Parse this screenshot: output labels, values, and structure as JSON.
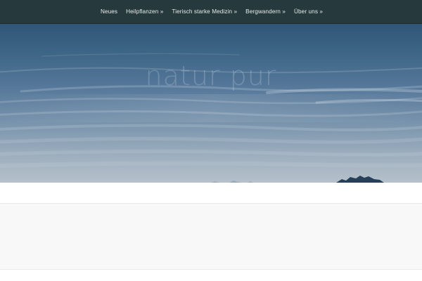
{
  "nav": {
    "items": [
      {
        "label": "Neues"
      },
      {
        "label": "Heilpflanzen »"
      },
      {
        "label": "Tierisch starke Medizin »"
      },
      {
        "label": "Bergwandern »"
      },
      {
        "label": "Über uns »"
      }
    ]
  },
  "hero": {
    "title": "natur pur"
  },
  "colors": {
    "nav_bg": "#263a3d",
    "nav_text": "#e6ecec",
    "content_bg": "#f8f8f8"
  }
}
